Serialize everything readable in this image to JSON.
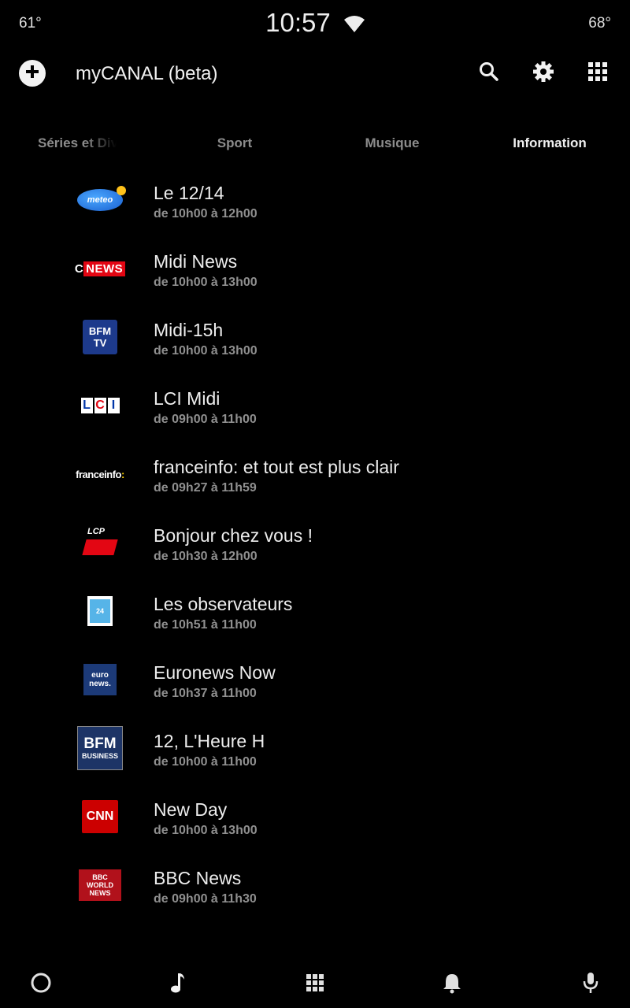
{
  "status": {
    "left_temp": "61°",
    "time": "10:57",
    "right_temp": "68°"
  },
  "appbar": {
    "title": "myCANAL (beta)"
  },
  "tabs": [
    {
      "label": "Séries et Divertissement"
    },
    {
      "label": "Sport"
    },
    {
      "label": "Musique"
    },
    {
      "label": "Information",
      "selected": true
    }
  ],
  "programs": [
    {
      "channel_icon": "la-chaine-meteo-logo",
      "title": "Le 12/14",
      "time": "de 10h00 à 12h00"
    },
    {
      "channel_icon": "cnews-logo",
      "title": "Midi News",
      "time": "de 10h00 à 13h00"
    },
    {
      "channel_icon": "bfmtv-logo",
      "title": "Midi-15h",
      "time": "de 10h00 à 13h00"
    },
    {
      "channel_icon": "lci-logo",
      "title": "LCI Midi",
      "time": "de 09h00 à 11h00"
    },
    {
      "channel_icon": "franceinfo-logo",
      "title": "franceinfo: et tout est plus clair",
      "time": "de 09h27 à 11h59"
    },
    {
      "channel_icon": "lcp-logo",
      "title": "Bonjour chez vous !",
      "time": "de 10h30 à 12h00"
    },
    {
      "channel_icon": "france24-logo",
      "title": "Les observateurs",
      "time": "de 10h51 à 11h00"
    },
    {
      "channel_icon": "euronews-logo",
      "title": "Euronews Now",
      "time": "de 10h37 à 11h00"
    },
    {
      "channel_icon": "bfm-business-logo",
      "title": "12, L'Heure H",
      "time": "de 10h00 à 11h00"
    },
    {
      "channel_icon": "cnn-logo",
      "title": "New Day",
      "time": "de 10h00 à 13h00"
    },
    {
      "channel_icon": "bbc-world-news-logo",
      "title": "BBC News",
      "time": "de 09h00 à 11h30"
    }
  ],
  "logos": {
    "meteo": "meteo",
    "cnews_c": "C",
    "cnews_n": "NEWS",
    "bfmtv": "BFM TV",
    "lci": [
      "L",
      "C",
      "I"
    ],
    "franceinfo_a": "franceinfo",
    "franceinfo_b": ":",
    "lcp": "LCP",
    "france24": "24",
    "euronews": "euro news.",
    "bfm_big": "BFM",
    "bfm_small": "BUSINESS",
    "cnn": "CNN",
    "bbc": "BBC WORLD NEWS"
  },
  "colors": {
    "background": "#000000",
    "text_primary": "#ededed",
    "text_secondary": "#8f8f8f",
    "tab_inactive": "#8c8c8c",
    "tab_active": "#f0f0f0"
  }
}
